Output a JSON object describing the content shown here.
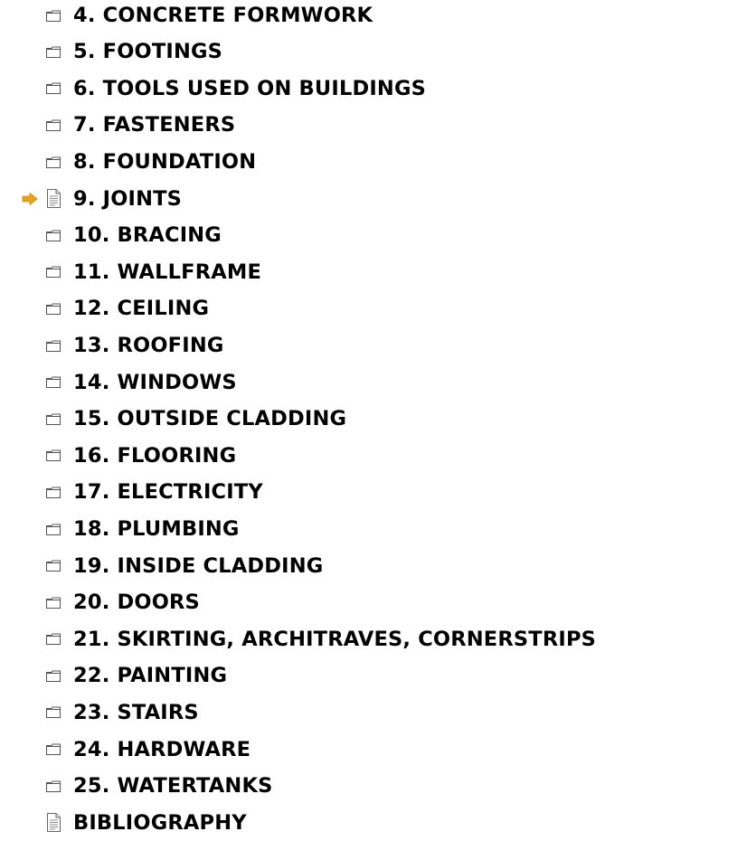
{
  "toc": {
    "items": [
      {
        "label": "4. CONCRETE FORMWORK",
        "icon": "folder-icon",
        "current": false
      },
      {
        "label": "5. FOOTINGS",
        "icon": "folder-icon",
        "current": false
      },
      {
        "label": "6. TOOLS USED ON BUILDINGS",
        "icon": "folder-icon",
        "current": false
      },
      {
        "label": "7. FASTENERS",
        "icon": "folder-icon",
        "current": false
      },
      {
        "label": "8. FOUNDATION",
        "icon": "folder-icon",
        "current": false
      },
      {
        "label": "9. JOINTS",
        "icon": "document-icon",
        "current": true
      },
      {
        "label": "10. BRACING",
        "icon": "folder-icon",
        "current": false
      },
      {
        "label": "11. WALLFRAME",
        "icon": "folder-icon",
        "current": false
      },
      {
        "label": "12. CEILING",
        "icon": "folder-icon",
        "current": false
      },
      {
        "label": "13. ROOFING",
        "icon": "folder-icon",
        "current": false
      },
      {
        "label": "14. WINDOWS",
        "icon": "folder-icon",
        "current": false
      },
      {
        "label": "15. OUTSIDE CLADDING",
        "icon": "folder-icon",
        "current": false
      },
      {
        "label": "16. FLOORING",
        "icon": "folder-icon",
        "current": false
      },
      {
        "label": "17. ELECTRICITY",
        "icon": "folder-icon",
        "current": false
      },
      {
        "label": "18. PLUMBING",
        "icon": "folder-icon",
        "current": false
      },
      {
        "label": "19. INSIDE CLADDING",
        "icon": "folder-icon",
        "current": false
      },
      {
        "label": "20. DOORS",
        "icon": "folder-icon",
        "current": false
      },
      {
        "label": "21. SKIRTING, ARCHITRAVES, CORNERSTRIPS",
        "icon": "folder-icon",
        "current": false
      },
      {
        "label": "22. PAINTING",
        "icon": "folder-icon",
        "current": false
      },
      {
        "label": "23. STAIRS",
        "icon": "folder-icon",
        "current": false
      },
      {
        "label": "24. HARDWARE",
        "icon": "folder-icon",
        "current": false
      },
      {
        "label": "25. WATERTANKS",
        "icon": "folder-icon",
        "current": false
      },
      {
        "label": "BIBLIOGRAPHY",
        "icon": "document-icon",
        "current": false
      }
    ]
  },
  "colors": {
    "text": "#000000",
    "current_arrow": "#e8a317",
    "icon_stroke": "#555555"
  }
}
